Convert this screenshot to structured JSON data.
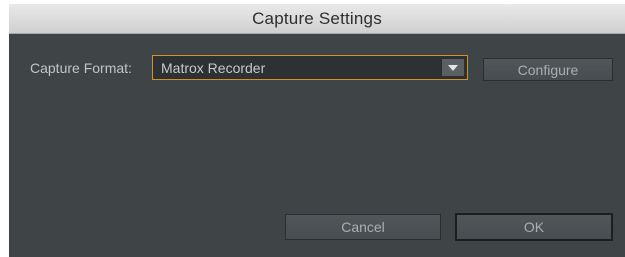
{
  "window": {
    "title": "Capture Settings"
  },
  "capture_format": {
    "label": "Capture Format:",
    "selected": "Matrox Recorder"
  },
  "buttons": {
    "configure": "Configure",
    "cancel": "Cancel",
    "ok": "OK"
  },
  "colors": {
    "panel_background": "#3f4446",
    "focus_border": "#d2941f",
    "titlebar": "#dcdcdc"
  },
  "icons": {
    "dropdown": "chevron-down-icon"
  }
}
